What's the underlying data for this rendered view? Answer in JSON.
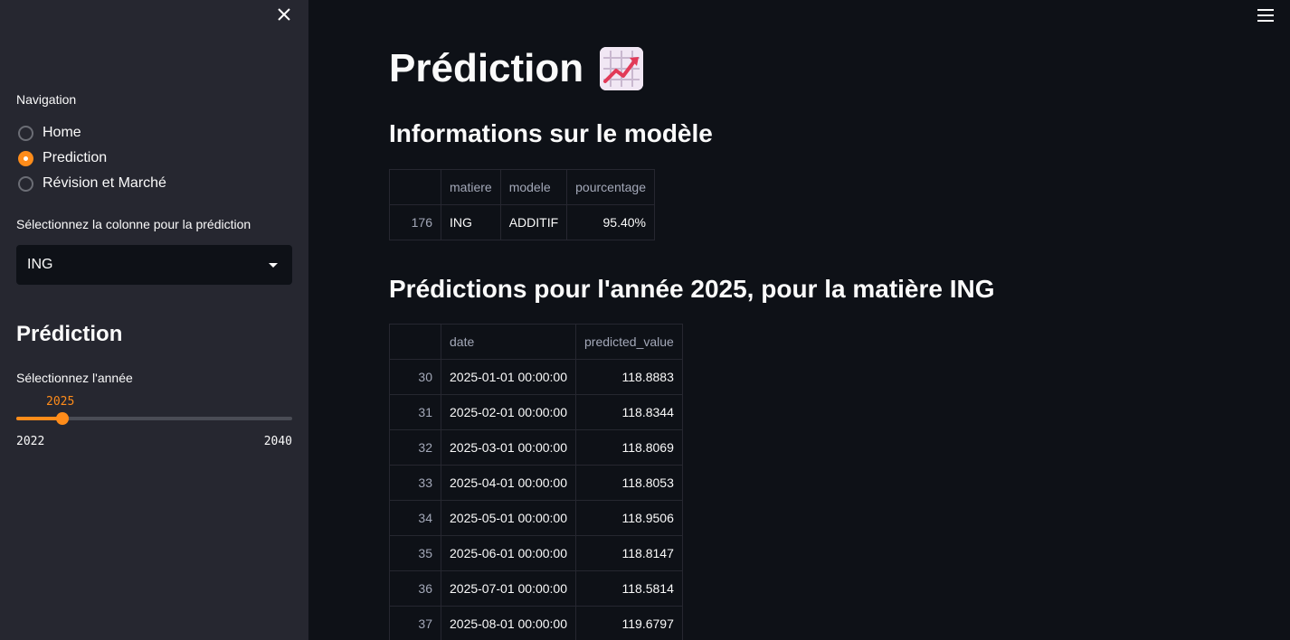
{
  "sidebar": {
    "navigation_label": "Navigation",
    "nav_options": [
      {
        "label": "Home",
        "selected": false
      },
      {
        "label": "Prediction",
        "selected": true
      },
      {
        "label": "Révision et Marché",
        "selected": false
      }
    ],
    "select_label": "Sélectionnez la colonne pour la prédiction",
    "select_value": "ING",
    "heading": "Prédiction",
    "slider": {
      "label": "Sélectionnez l'année",
      "value": "2025",
      "min": "2022",
      "max": "2040",
      "fraction": 0.1667
    }
  },
  "main": {
    "title": "Prédiction",
    "model_heading": "Informations sur le modèle",
    "model_table": {
      "columns": [
        "",
        "matiere",
        "modele",
        "pourcentage"
      ],
      "rows": [
        [
          "176",
          "ING",
          "ADDITIF",
          "95.40%"
        ]
      ]
    },
    "predictions_heading": "Prédictions pour l'année 2025, pour la matière ING",
    "predictions_table": {
      "columns": [
        "",
        "date",
        "predicted_value"
      ],
      "rows": [
        [
          "30",
          "2025-01-01 00:00:00",
          "118.8883"
        ],
        [
          "31",
          "2025-02-01 00:00:00",
          "118.8344"
        ],
        [
          "32",
          "2025-03-01 00:00:00",
          "118.8069"
        ],
        [
          "33",
          "2025-04-01 00:00:00",
          "118.8053"
        ],
        [
          "34",
          "2025-05-01 00:00:00",
          "118.9506"
        ],
        [
          "35",
          "2025-06-01 00:00:00",
          "118.8147"
        ],
        [
          "36",
          "2025-07-01 00:00:00",
          "118.5814"
        ],
        [
          "37",
          "2025-08-01 00:00:00",
          "119.6797"
        ]
      ]
    }
  },
  "colors": {
    "accent": "#ff8c1a",
    "sidebar_bg": "#262730",
    "main_bg": "#0e1117"
  }
}
